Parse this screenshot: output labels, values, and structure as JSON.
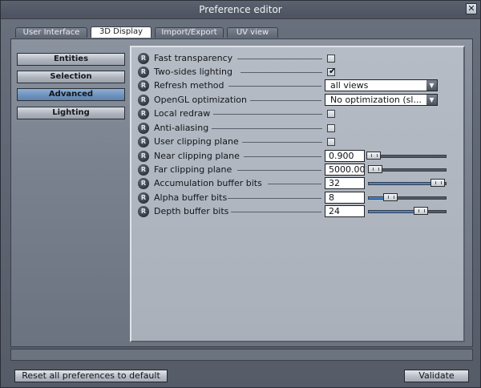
{
  "window": {
    "title": "Preference editor",
    "close_glyph": "✕"
  },
  "tabs": [
    {
      "label": "User Interface",
      "active": false
    },
    {
      "label": "3D Display",
      "active": true
    },
    {
      "label": "Import/Export",
      "active": false
    },
    {
      "label": "UV view",
      "active": false
    }
  ],
  "sidebar": {
    "items": [
      {
        "label": "Entities",
        "selected": false
      },
      {
        "label": "Selection",
        "selected": false
      },
      {
        "label": "Advanced",
        "selected": true
      },
      {
        "label": "Lighting",
        "selected": false
      }
    ]
  },
  "settings": [
    {
      "label": "Fast transparency",
      "type": "checkbox",
      "checked": false,
      "reset_icon": "R"
    },
    {
      "label": "Two-sides lighting",
      "type": "checkbox",
      "checked": true,
      "reset_icon": "R"
    },
    {
      "label": "Refresh method",
      "type": "combo",
      "value": "all views",
      "reset_icon": "R"
    },
    {
      "label": "OpenGL optimization",
      "type": "combo",
      "value": "No optimization (sl...",
      "reset_icon": "R"
    },
    {
      "label": "Local redraw",
      "type": "checkbox",
      "checked": false,
      "reset_icon": "R"
    },
    {
      "label": "Anti-aliasing",
      "type": "checkbox",
      "checked": false,
      "reset_icon": "R"
    },
    {
      "label": "User clipping plane",
      "type": "checkbox",
      "checked": false,
      "reset_icon": "R"
    },
    {
      "label": "Near clipping plane",
      "type": "slider",
      "value": "0.900",
      "level": 0.06,
      "reset_icon": "R"
    },
    {
      "label": "Far clipping plane",
      "type": "slider",
      "value": "5000.00",
      "level": 0.08,
      "reset_icon": "R"
    },
    {
      "label": "Accumulation buffer bits",
      "type": "slider",
      "value": "32",
      "level": 0.9,
      "reset_icon": "R"
    },
    {
      "label": "Alpha buffer bits",
      "type": "slider",
      "value": "8",
      "level": 0.28,
      "reset_icon": "R"
    },
    {
      "label": "Depth buffer bits",
      "type": "slider",
      "value": "24",
      "level": 0.68,
      "reset_icon": "R"
    }
  ],
  "footer": {
    "reset_label": "Reset all preferences to default",
    "validate_label": "Validate"
  },
  "colors": {
    "accent": "#3f86d6",
    "selected_button": "#6e93bd",
    "panel": "#a9b0ba"
  }
}
